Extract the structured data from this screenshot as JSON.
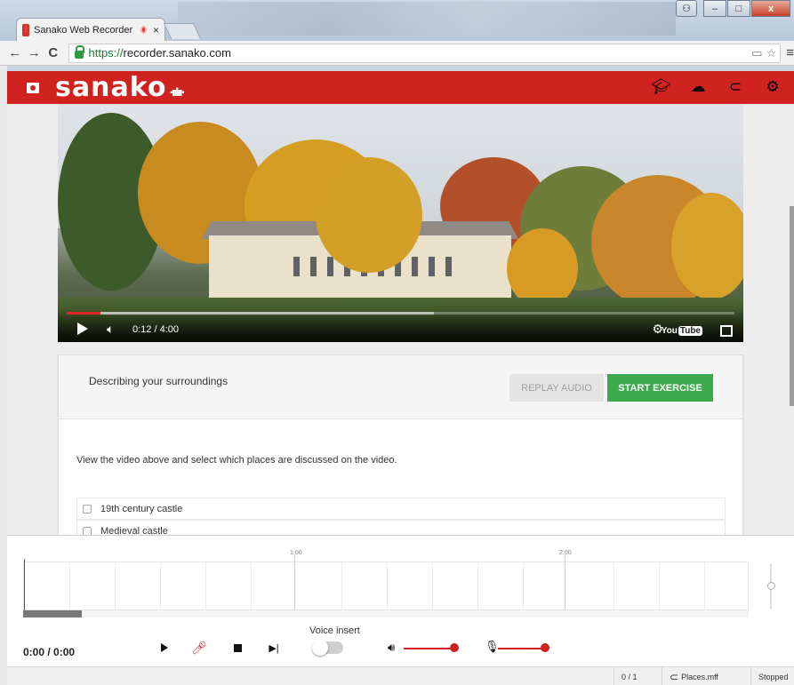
{
  "browser": {
    "tab_title": "Sanako Web Recorder",
    "tab_close": "×",
    "url_scheme": "https://",
    "url_host": "recorder.sanako.com",
    "nav": {
      "back": "←",
      "forward": "→",
      "reload": "C"
    },
    "window_buttons": {
      "minimize": "–",
      "maximize": "□",
      "close": "x"
    },
    "menu": "≡"
  },
  "app": {
    "logo_text": "sanako",
    "brand_color": "#d0221f",
    "header_icons": [
      "graduation-cap-icon",
      "cloud-icon",
      "paperclip-icon",
      "gear-icon"
    ]
  },
  "video": {
    "time": "0:12 / 4:00",
    "progress": 0.05,
    "buffered": 0.55,
    "youtube_text": "You",
    "youtube_tube": "Tube"
  },
  "exercise": {
    "title": "Describing your surroundings",
    "replay_label": "REPLAY AUDIO",
    "start_label": "START EXERCISE",
    "instruction": "View the video above and select which places are discussed on the video.",
    "options": [
      "19th century castle",
      "Medieval castle"
    ]
  },
  "recorder": {
    "ruler_labels": [
      "1:00",
      "2:00"
    ],
    "time": "0:00 / 0:00",
    "voice_insert_label": "Voice insert",
    "voice_insert_on": false,
    "playback_volume": 0.95,
    "mic_volume": 0.95
  },
  "statusbar": {
    "track": "0 / 1",
    "file": "Places.mff",
    "state": "Stopped"
  }
}
